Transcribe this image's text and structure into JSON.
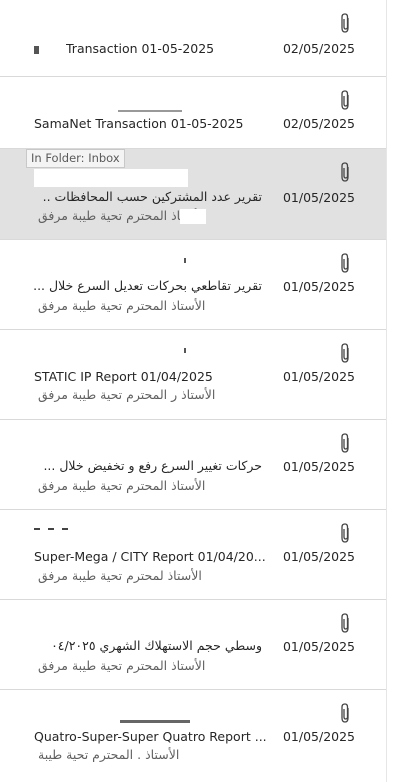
{
  "icons": {
    "attachment": "paperclip-icon"
  },
  "tooltip": "In Folder: Inbox",
  "messages": [
    {
      "subject": "Transaction 01-05-2025",
      "date": "02/05/2025",
      "preview": ""
    },
    {
      "subject": "SamaNet Transaction 01-05-2025",
      "date": "02/05/2025",
      "preview": ""
    },
    {
      "subject": "تقرير عدد المشتركين حسب المحافظات ..",
      "date": "01/05/2025",
      "preview": "الأستاذ         المحترم  تحية طيبة  مرفق"
    },
    {
      "subject": "تقرير تقاطعي بحركات تعديل السرع خلال ...",
      "date": "01/05/2025",
      "preview": "الأستاذ              المحترم  تحية طيبة  مرفق"
    },
    {
      "subject": "STATIC IP Report  01/04/2025",
      "date": "01/05/2025",
      "preview": "الأستاذ    ر المحترم  تحية طيبة  مرفق"
    },
    {
      "subject": "حركات تغيير السرع  رفع  و تخفيض خلال ...",
      "date": "01/05/2025",
      "preview": "الأستاذ         المحترم  تحية طيبة  مرفق"
    },
    {
      "subject": "Super-Mega / CITY Report   01/04/20...",
      "date": "01/05/2025",
      "preview": "الأستاذ        لمحترم  تحية طيبة  مرفق"
    },
    {
      "subject": "وسطي حجم الاستهلاك الشهري ٠٤/٢٠٢٥",
      "date": "01/05/2025",
      "preview": "الأستاذ         المحترم  تحية طيبة  مرفق"
    },
    {
      "subject": "Quatro-Super-Super Quatro Report  ...",
      "date": "01/05/2025",
      "preview": "الأستاذ   .  المحترم  تحية طيبة"
    }
  ]
}
